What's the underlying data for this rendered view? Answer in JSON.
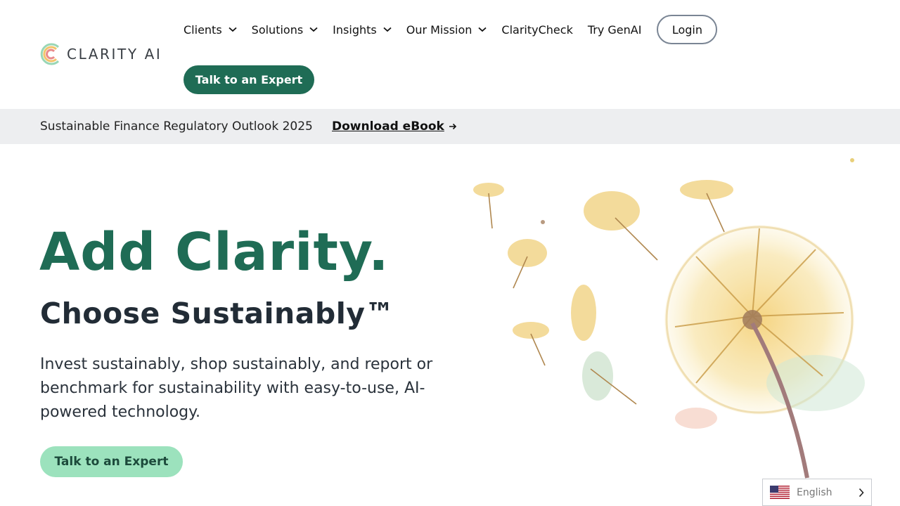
{
  "brand": {
    "name": "CLARITY AI"
  },
  "nav": {
    "items": [
      {
        "label": "Clients",
        "has_dropdown": true
      },
      {
        "label": "Solutions",
        "has_dropdown": true
      },
      {
        "label": "Insights",
        "has_dropdown": true
      },
      {
        "label": "Our Mission",
        "has_dropdown": true
      },
      {
        "label": "ClarityCheck",
        "has_dropdown": false
      },
      {
        "label": "Try GenAI",
        "has_dropdown": false
      }
    ],
    "login_label": "Login",
    "cta_label": "Talk to an Expert"
  },
  "banner": {
    "text": "Sustainable Finance Regulatory Outlook 2025",
    "link_label": "Download eBook",
    "link_icon": "arrow-right-icon"
  },
  "hero": {
    "title": "Add Clarity.",
    "subtitle": "Choose Sustainably™",
    "description": "Invest sustainably, shop sustainably, and report or benchmark for sustainability with easy-to-use, AI-powered technology.",
    "cta_label": "Talk to an Expert",
    "image": "watercolor-dandelion"
  },
  "language": {
    "label": "English",
    "flag": "us-flag-icon"
  },
  "colors": {
    "brand_green": "#1f6c55",
    "light_green": "#9ce2bd",
    "banner_bg": "#edeef0"
  }
}
